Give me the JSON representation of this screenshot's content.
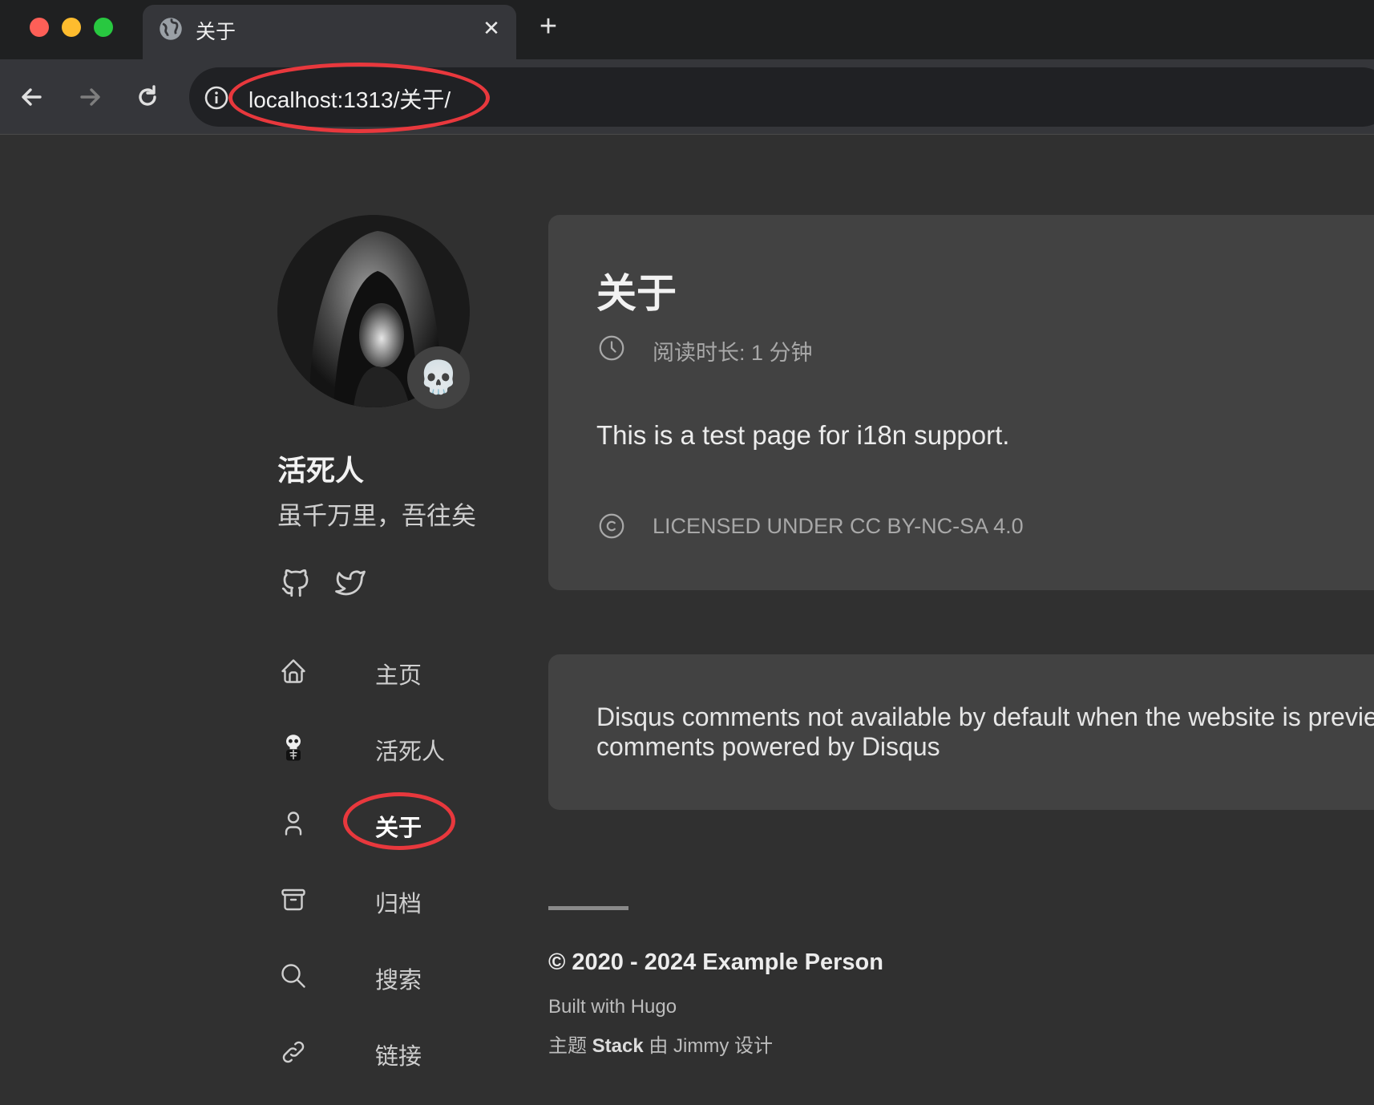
{
  "browser": {
    "tab_title": "关于",
    "tab_close": "✕",
    "new_tab": "+",
    "url": "localhost:1313/关于/"
  },
  "sidebar": {
    "avatar_emoji": "💀",
    "site_name": "活死人",
    "site_description": "虽千万里，吾往矣",
    "social": [
      "github-icon",
      "twitter-icon"
    ],
    "menu": [
      {
        "label": "主页",
        "icon": "home-icon",
        "active": false
      },
      {
        "label": "活死人",
        "icon": "skeleton-emoji-icon",
        "active": false
      },
      {
        "label": "关于",
        "icon": "user-icon",
        "active": true
      },
      {
        "label": "归档",
        "icon": "archive-icon",
        "active": false
      },
      {
        "label": "搜索",
        "icon": "search-icon",
        "active": false
      },
      {
        "label": "链接",
        "icon": "link-icon",
        "active": false
      }
    ]
  },
  "article": {
    "title": "关于",
    "reading_time": "阅读时长: 1 分钟",
    "body": "This is a test page for i18n support.",
    "license": "LICENSED UNDER CC BY-NC-SA 4.0"
  },
  "comments": {
    "text": "Disqus comments not available by default when the website is preview\ncomments powered by Disqus"
  },
  "footer": {
    "copyright": "© 2020 - 2024 Example Person",
    "built_with": "Built with Hugo",
    "theme_prefix": "主题",
    "theme_name": "Stack",
    "theme_suffix": "由 Jimmy 设计"
  },
  "colors": {
    "page_bg": "#303030",
    "card_bg": "#424242",
    "annotation_ring": "#e8383d"
  }
}
